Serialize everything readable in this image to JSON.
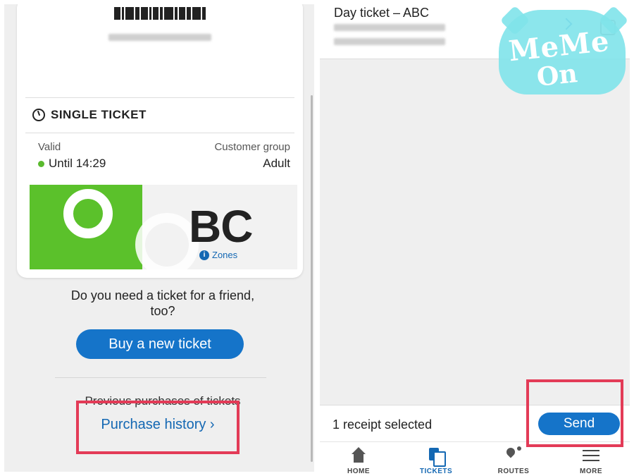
{
  "left_panel": {
    "ticket": {
      "type_label": "SINGLE TICKET",
      "valid_label": "Valid",
      "valid_value": "Until 14:29",
      "customer_group_label": "Customer group",
      "customer_group_value": "Adult",
      "zone": "BC",
      "zones_link": "Zones"
    },
    "friend_prompt": "Do you need a ticket for a friend, too?",
    "buy_button": "Buy a new ticket",
    "previous_purchases_label": "Previous purchases of tickets",
    "purchase_history_link": "Purchase history ›"
  },
  "right_panel": {
    "receipt_title": "Day ticket – ABC",
    "selected_text": "1 receipt selected",
    "send_button": "Send",
    "watermark_line1": "MeMe",
    "watermark_line2": "On",
    "tabs": [
      {
        "label": "HOME",
        "icon": "home-icon"
      },
      {
        "label": "TICKETS",
        "icon": "tickets-icon"
      },
      {
        "label": "ROUTES",
        "icon": "routes-icon"
      },
      {
        "label": "MORE",
        "icon": "menu-icon"
      }
    ]
  },
  "colors": {
    "accent": "#1574c9",
    "valid_dot": "#5aba2e",
    "zone_green": "#5bc12b",
    "highlight": "#e33b57"
  }
}
